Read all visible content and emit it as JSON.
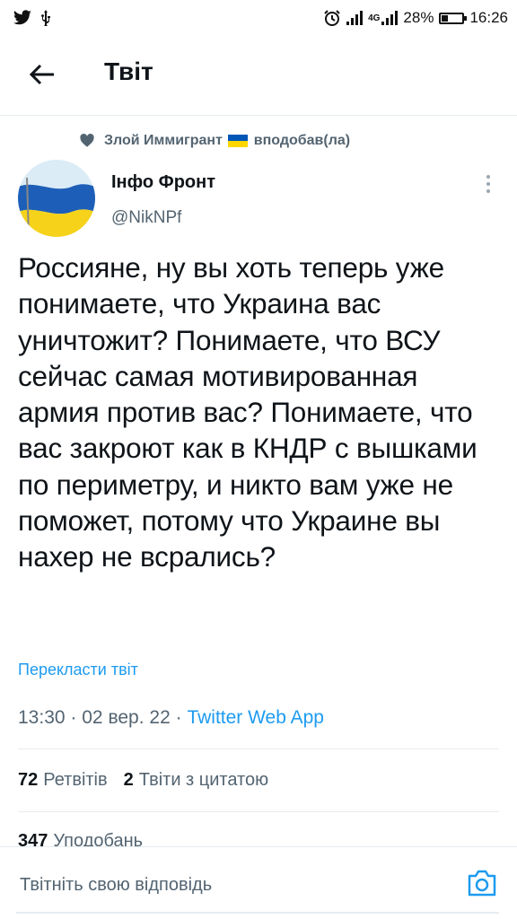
{
  "status_bar": {
    "time": "16:26",
    "battery": "28%",
    "battery_level": 0.28,
    "network": "4G",
    "left_icons": [
      "twitter-bird-icon",
      "usb-icon"
    ],
    "right_icons": [
      "alarm-icon",
      "signal-icon",
      "signal-4g-icon",
      "battery-icon"
    ]
  },
  "header": {
    "title": "Твіт",
    "back_icon": "arrow-left-icon"
  },
  "tweet": {
    "social_context": {
      "user": "Злой Иммигрант",
      "action": "вподобав(ла)"
    },
    "author": {
      "name": "Інфо Фронт",
      "handle": "@NikNPf"
    },
    "text": "Россияне, ну вы хоть теперь уже понимаете, что Украина вас уничтожит? Понимаете, что ВСУ сейчас самая мотивированная армия против вас? Понимаете, что вас закроют как в КНДР с вышками по периметру, и никто вам уже не поможет, потому что Украине вы нахер не всрались?",
    "translate_label": "Перекласти твіт",
    "time": "13:30",
    "date": "02 вер. 22",
    "separator": "·",
    "source": "Twitter Web App",
    "stats": {
      "retweets_count": "72",
      "retweets_label": "Ретвітів",
      "quotes_count": "2",
      "quotes_label": "Твіти з цитатою",
      "likes_count": "347",
      "likes_label": "Уподобань"
    }
  },
  "reply": {
    "placeholder": "Твітніть свою відповідь"
  },
  "colors": {
    "accent": "#1d9bf0",
    "text": "#0f1419",
    "secondary": "#536471",
    "divider": "#e6ecf0",
    "flag_blue": "#0057b7",
    "flag_yellow": "#ffd700"
  }
}
